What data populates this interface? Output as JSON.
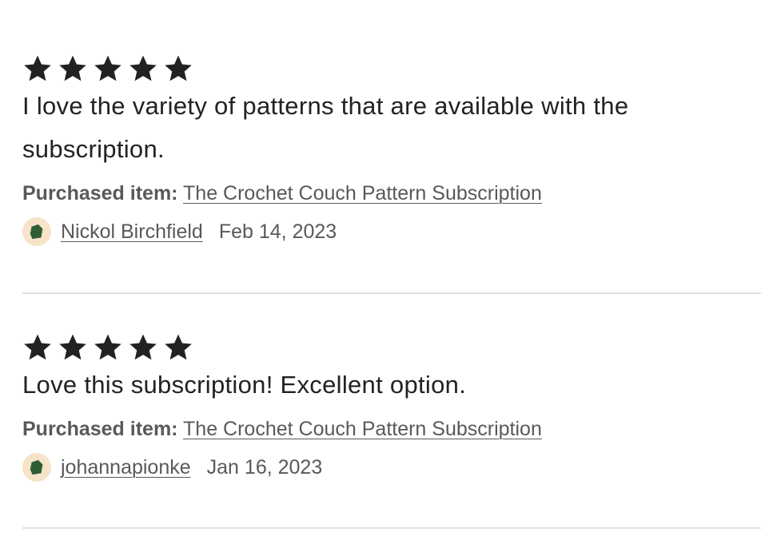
{
  "reviews": [
    {
      "rating": 5,
      "star_icon": "star-icon",
      "text": "I love the variety of patterns that are available with the subscription.",
      "purchased_label": "Purchased item:",
      "purchased_item": "The Crochet Couch Pattern Subscription",
      "reviewer_name": "Nickol Birchfield",
      "date": "Feb 14, 2023"
    },
    {
      "rating": 5,
      "star_icon": "star-icon",
      "text": "Love this subscription! Excellent option.",
      "purchased_label": "Purchased item:",
      "purchased_item": "The Crochet Couch Pattern Subscription",
      "reviewer_name": "johannapionke",
      "date": "Jan 16, 2023"
    }
  ],
  "colors": {
    "star": "#222222",
    "muted_text": "#595959",
    "avatar_bg": "#f6e3c8",
    "avatar_icon": "#2f5e34",
    "divider": "#e1e1e1"
  }
}
